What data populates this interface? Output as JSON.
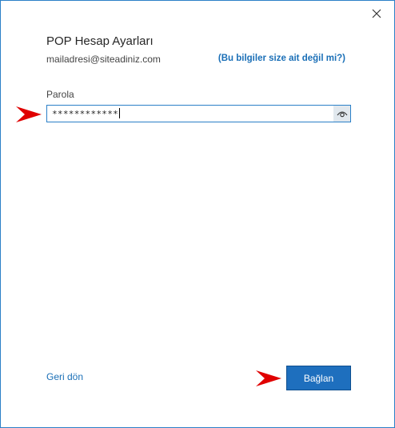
{
  "dialog": {
    "title": "POP Hesap Ayarları",
    "email": "mailadresi@siteadiniz.com",
    "not_you_link": "(Bu bilgiler size ait değil mi?)",
    "password_label": "Parola",
    "password_value": "************",
    "back_link": "Geri dön",
    "connect_button": "Bağlan"
  },
  "icons": {
    "close": "close-icon",
    "reveal": "eye-icon",
    "annotation": "red-arrow-icon"
  },
  "colors": {
    "accent": "#1e6fbe",
    "link": "#1a6fb7",
    "annotation_arrow": "#e00000"
  }
}
